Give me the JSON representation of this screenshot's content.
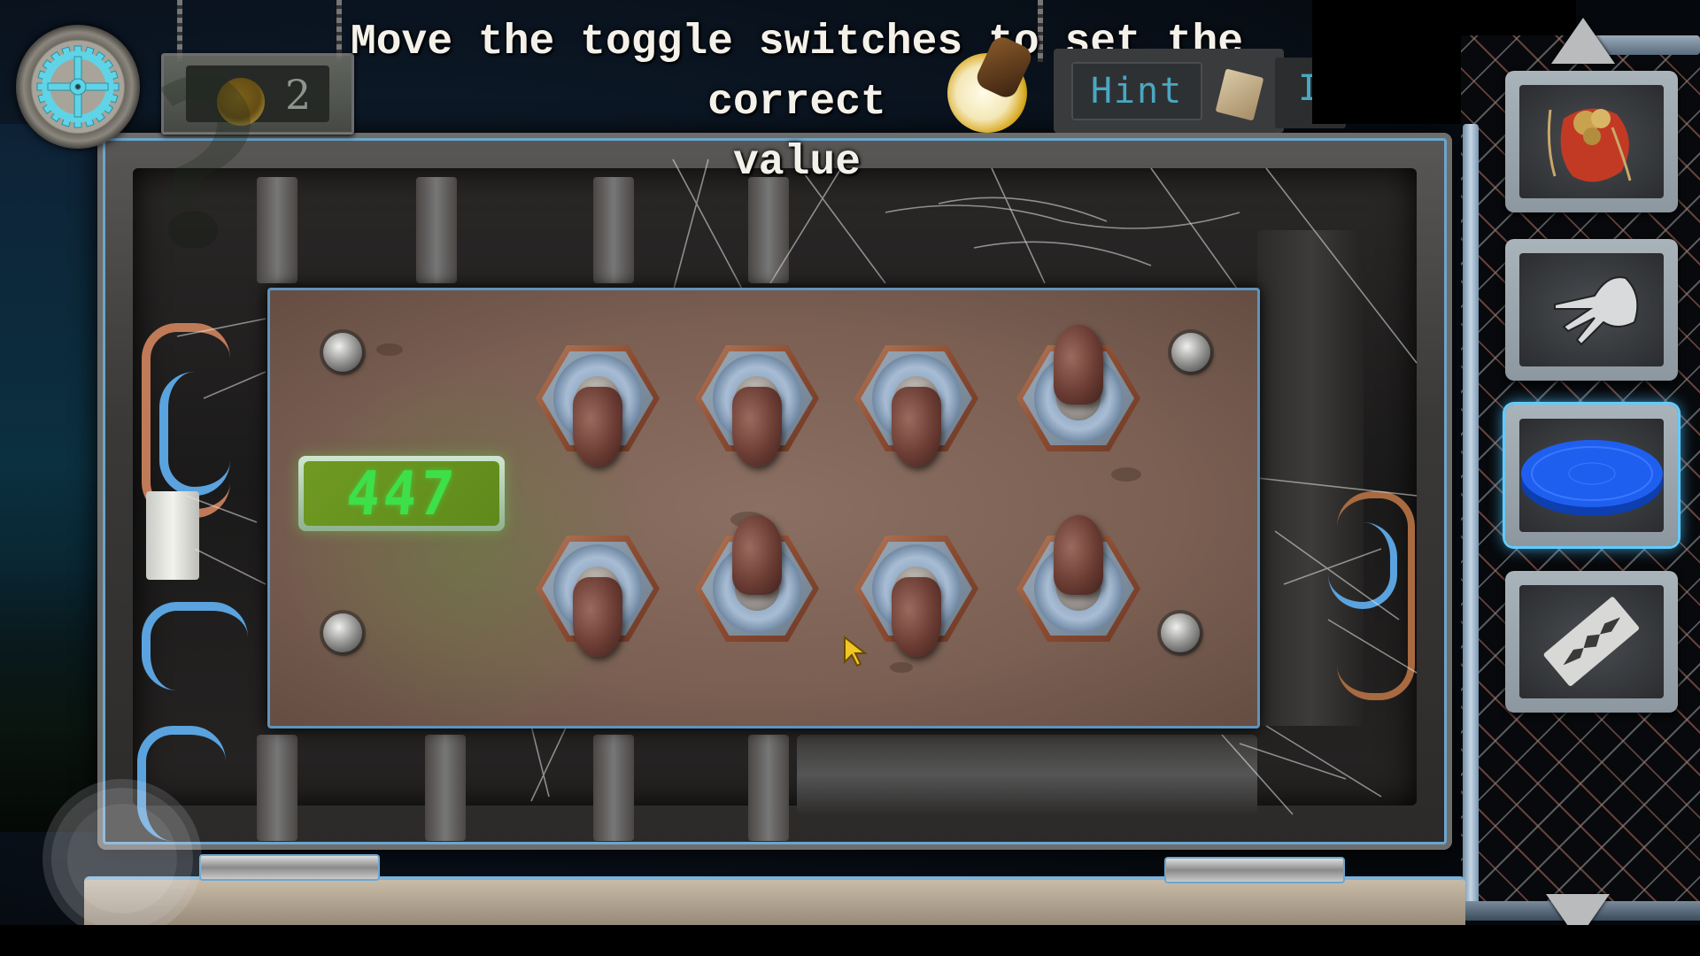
{
  "hud": {
    "settings_icon": "gear-icon",
    "coins": {
      "icon": "skull-coin-icon",
      "count": "2"
    },
    "instruction": "Move the toggle switches to set the correct value",
    "instruction_lines": [
      "Move the toggle switches to set the correct",
      "value"
    ],
    "hint_label": "Hint",
    "map_icon": "map-icon",
    "journal_label_partial": "I"
  },
  "puzzle": {
    "display_value": "447",
    "display_color": "#3ee04a",
    "switches": {
      "top_row": [
        "down",
        "down",
        "down",
        "up"
      ],
      "bottom_row": [
        "down",
        "up",
        "down",
        "up"
      ]
    }
  },
  "inventory": {
    "scroll_up_icon": "triangle-up-icon",
    "scroll_down_icon": "triangle-down-icon",
    "items": [
      {
        "name": "red-sack-of-nuggets",
        "icon": "red-pouch-icon",
        "selected": false
      },
      {
        "name": "metal-claw",
        "icon": "claw-icon",
        "selected": false
      },
      {
        "name": "blue-lid",
        "icon": "blue-disc-icon",
        "selected": true
      },
      {
        "name": "razor-blade",
        "icon": "razor-blade-icon",
        "selected": false
      }
    ],
    "selection_color": "#4fc3ff"
  },
  "controls": {
    "joystick_icon": "virtual-joystick"
  }
}
